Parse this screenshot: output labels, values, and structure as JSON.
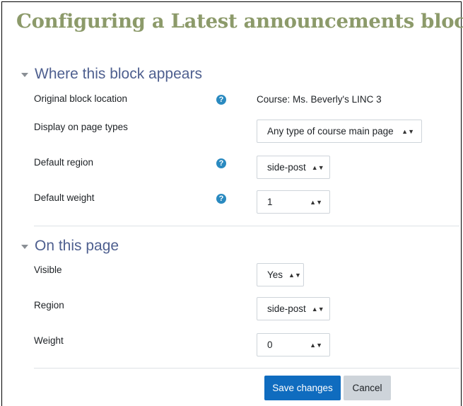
{
  "page": {
    "title": "Configuring a Latest announcements block"
  },
  "sections": {
    "where": {
      "title": "Where this block appears",
      "original_location_label": "Original block location",
      "original_location_value": "Course: Ms. Beverly's LINC 3",
      "page_types_label": "Display on page types",
      "page_types_value": "Any type of course main page",
      "default_region_label": "Default region",
      "default_region_value": "side-post",
      "default_weight_label": "Default weight",
      "default_weight_value": "1"
    },
    "on_this_page": {
      "title": "On this page",
      "visible_label": "Visible",
      "visible_value": "Yes",
      "region_label": "Region",
      "region_value": "side-post",
      "weight_label": "Weight",
      "weight_value": "0"
    }
  },
  "buttons": {
    "save": "Save changes",
    "cancel": "Cancel"
  },
  "icons": {
    "help": "help-icon",
    "collapse": "caret-down-icon",
    "select_arrows": "up-down-arrow-icon"
  },
  "colors": {
    "title": "#8c9a6a",
    "section_title": "#4e5f8f",
    "help_icon": "#2a8ac0",
    "primary_button": "#0f6cbf",
    "secondary_button": "#ced4da"
  }
}
